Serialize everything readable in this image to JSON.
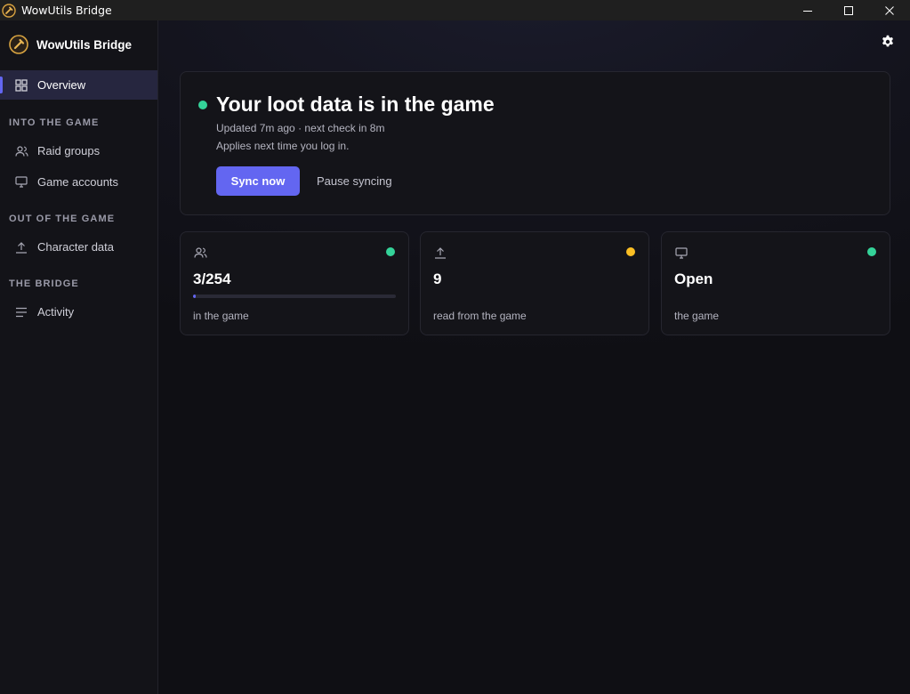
{
  "window": {
    "title": "WowUtils Bridge",
    "controls": [
      "minimize-icon",
      "maximize-icon",
      "close-icon"
    ]
  },
  "sidebar": {
    "brand": "WowUtils Bridge",
    "overview": {
      "label": "Overview",
      "icon": "grid-icon",
      "active": true
    },
    "sections": [
      {
        "label": "INTO THE GAME",
        "items": [
          {
            "label": "Raid groups",
            "icon": "users-icon"
          },
          {
            "label": "Game accounts",
            "icon": "monitor-icon"
          }
        ]
      },
      {
        "label": "OUT OF THE GAME",
        "items": [
          {
            "label": "Character data",
            "icon": "upload-icon"
          }
        ]
      },
      {
        "label": "THE BRIDGE",
        "items": [
          {
            "label": "Activity",
            "icon": "list-icon"
          }
        ]
      }
    ]
  },
  "header": {
    "settings_icon": "gear-icon"
  },
  "status": {
    "title": "Your loot data is in the game",
    "status_color": "#34d399",
    "updated": "Updated 7m ago · next check in 8m",
    "applies": "Applies next time you log in.",
    "sync_label": "Sync now",
    "pause_label": "Pause syncing"
  },
  "cards": [
    {
      "icon": "users-icon",
      "value": "3/254",
      "label": "in the game",
      "dot_color": "#34d399",
      "progress": 0.012
    },
    {
      "icon": "upload-icon",
      "value": "9",
      "label": "read from the game",
      "dot_color": "#fbbf24"
    },
    {
      "icon": "monitor-icon",
      "value": "Open",
      "label": "the game",
      "dot_color": "#34d399"
    }
  ],
  "colors": {
    "accent": "#6366f1",
    "ok": "#34d399",
    "warn": "#fbbf24"
  }
}
